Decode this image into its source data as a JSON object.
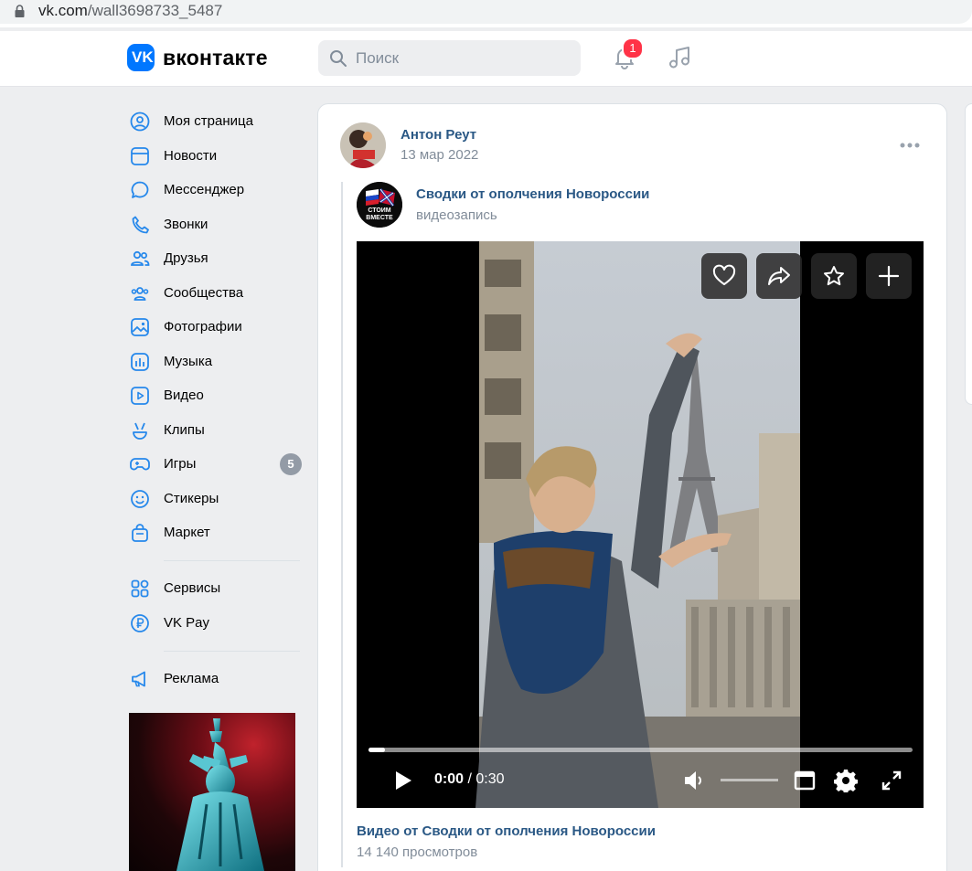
{
  "browser": {
    "url_host": "vk.com",
    "url_path": "/wall3698733_5487"
  },
  "header": {
    "logo_text": "вконтакте",
    "search_placeholder": "Поиск",
    "notifications_count": "1"
  },
  "sidebar": {
    "items": [
      {
        "label": "Моя страница",
        "icon": "user-circle-icon"
      },
      {
        "label": "Новости",
        "icon": "newsfeed-icon"
      },
      {
        "label": "Мессенджер",
        "icon": "message-icon"
      },
      {
        "label": "Звонки",
        "icon": "phone-icon"
      },
      {
        "label": "Друзья",
        "icon": "friends-icon"
      },
      {
        "label": "Сообщества",
        "icon": "communities-icon"
      },
      {
        "label": "Фотографии",
        "icon": "photo-icon"
      },
      {
        "label": "Музыка",
        "icon": "music-icon"
      },
      {
        "label": "Видео",
        "icon": "video-icon"
      },
      {
        "label": "Клипы",
        "icon": "clips-icon"
      },
      {
        "label": "Игры",
        "icon": "gamepad-icon",
        "count": "5"
      },
      {
        "label": "Стикеры",
        "icon": "smile-icon"
      },
      {
        "label": "Маркет",
        "icon": "market-icon"
      }
    ],
    "services": [
      {
        "label": "Сервисы",
        "icon": "services-grid-icon"
      },
      {
        "label": "VK Pay",
        "icon": "vkpay-icon"
      }
    ],
    "ads": {
      "label": "Реклама",
      "icon": "megaphone-icon"
    }
  },
  "post": {
    "author": "Антон Реут",
    "date": "13 мар 2022",
    "repost": {
      "group_name": "Сводки от ополчения Новороссии",
      "type_label": "видеозапись",
      "avatar_text": "СТОИМ ВМЕСТЕ"
    },
    "video": {
      "current_time": "0:00",
      "separator": "/",
      "duration": "0:30",
      "progress_fraction": 0.03,
      "volume_fraction": 0.0,
      "title": "Видео от Сводки от ополчения Новороссии",
      "views": "14 140 просмотров"
    }
  },
  "colors": {
    "accent": "#0077ff",
    "link": "#2a5885",
    "muted": "#818c99",
    "badge": "#ff3347"
  }
}
